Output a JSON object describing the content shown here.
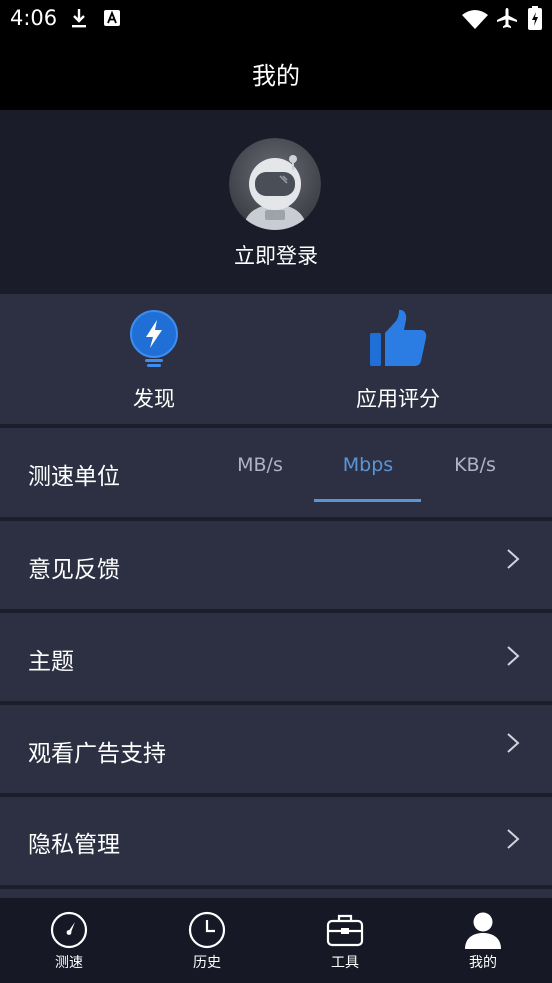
{
  "status_bar": {
    "time": "4:06",
    "icons": [
      "download-icon",
      "a-box-icon",
      "wifi-icon",
      "airplane-icon",
      "battery-icon"
    ]
  },
  "header": {
    "title": "我的"
  },
  "profile": {
    "login_label": "立即登录",
    "avatar_icon": "astronaut-avatar"
  },
  "quick_actions": [
    {
      "label": "发现",
      "icon": "lightbulb-bolt-icon"
    },
    {
      "label": "应用评分",
      "icon": "thumbs-up-icon"
    }
  ],
  "speed_unit": {
    "label": "测速单位",
    "options": [
      "MB/s",
      "Mbps",
      "KB/s"
    ],
    "selected": "Mbps"
  },
  "menu": [
    {
      "label": "意见反馈"
    },
    {
      "label": "主题"
    },
    {
      "label": "观看广告支持"
    },
    {
      "label": "隐私管理"
    }
  ],
  "bottom_nav": [
    {
      "label": "测速",
      "icon": "speedometer-icon"
    },
    {
      "label": "历史",
      "icon": "clock-icon"
    },
    {
      "label": "工具",
      "icon": "toolbox-icon"
    },
    {
      "label": "我的",
      "icon": "user-icon",
      "active": true
    }
  ],
  "colors": {
    "accent": "#5b95d8",
    "background": "#1a1d29",
    "card": "#2c3042",
    "nav_background": "#161925"
  }
}
